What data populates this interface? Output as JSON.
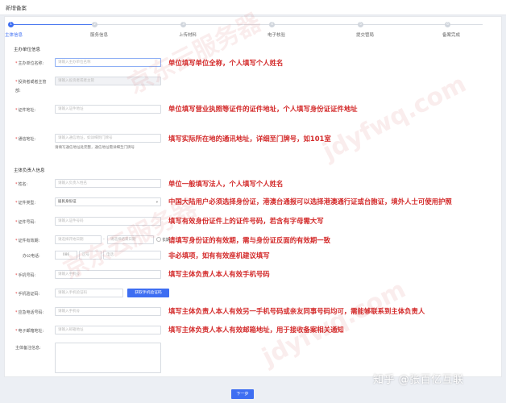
{
  "window": {
    "title": "新增备案"
  },
  "steps": [
    {
      "num": "1",
      "label": "主体信息",
      "active": true
    },
    {
      "num": "2",
      "label": "服务信息",
      "active": false
    },
    {
      "num": "3",
      "label": "上传材料",
      "active": false
    },
    {
      "num": "4",
      "label": "电子核验",
      "active": false
    },
    {
      "num": "5",
      "label": "提交管局",
      "active": false
    },
    {
      "num": "6",
      "label": "备案完成",
      "active": false
    }
  ],
  "sections": {
    "unit": "主办单位信息",
    "owner": "主体负责人信息"
  },
  "unit": {
    "name_label": "主办单位名称:",
    "name_placeholder": "请输入主办单位名称",
    "cert_label": "投资者或者主管",
    "cert_label_2": "部:",
    "cert_placeholder": "请输入投资者或者主管",
    "cert_addr_label": "证件地址:",
    "cert_addr_placeholder": "请输入证件地址",
    "comm_addr_label": "通信地址:",
    "comm_addr_placeholder": "请输入通信地址，如详细到门牌号",
    "comm_addr_hint": "请填写通信地址处完整，通信地址需详细至门牌号",
    "name_note": "单位填写单位全称，个人填写个人姓名",
    "cert_addr_note": "单位填写营业执照等证件的证件地址，个人填写身份证证件地址",
    "comm_addr_note": "填写实际所在地的通讯地址，详细至门牌号，如101室"
  },
  "owner": {
    "name_label": "姓名:",
    "name_placeholder": "请输入负责人姓名",
    "cert_type_label": "证件类型:",
    "cert_type_value": "居民身份证",
    "cert_no_label": "证件号码:",
    "cert_no_placeholder": "请输入证件号码",
    "validity_label": "证件有效期:",
    "validity_start": "请选择开始日期",
    "validity_end": "请选择结束日期",
    "validity_longterm": "长期",
    "office_phone_label": "办公电话:",
    "office_phone_prefix": "086",
    "office_phone_area": "区号",
    "office_phone_number": "电话",
    "mobile_label": "手机号码:",
    "mobile_placeholder": "请输入手机号",
    "code_label": "手机验证码:",
    "code_placeholder": "请输入手机验证码",
    "code_button": "获取手机验证码",
    "emergency_label": "应急电话号码:",
    "emergency_placeholder": "请输入手机号",
    "email_label": "电子邮箱地址:",
    "email_placeholder": "请输入邮箱地址",
    "remark_label": "主体备注信息:",
    "name_note": "单位一般填写法人，个人填写个人姓名",
    "cert_type_note": "中国大陆用户必须选择身份证，港澳台通报可以选择港澳通行证或台胞证，境外人士可使用护照",
    "cert_no_note": "填写有效身份证件上的证件号码，若含有字母需大写",
    "validity_note": "请填写身份证的有效期，需与身份证反面的有效期一致",
    "office_phone_note": "非必填项，如有有效座机建议填写",
    "mobile_note": "填写主体负责人本人有效手机号码",
    "emergency_note": "填写主体负责人本人有效另一手机号码或亲友同事号码均可，需能够联系到主体负责人",
    "email_note": "填写主体负责人本人有效邮箱地址，用于接收备案相关通知"
  },
  "footer": {
    "next_button": "下一步"
  },
  "watermark": {
    "brand": "京东云服务器",
    "url": "jdyfwq.com",
    "zhihu": "知乎 @张百亿互联"
  }
}
